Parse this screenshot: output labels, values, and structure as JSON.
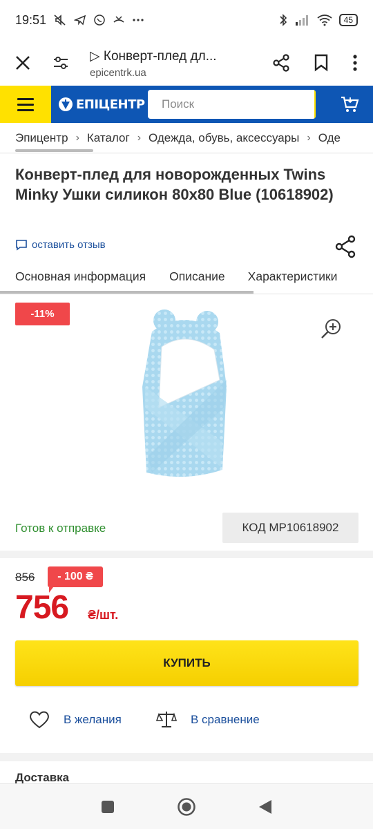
{
  "status_bar": {
    "time": "19:51",
    "battery": "45"
  },
  "browser": {
    "title": "▷ Конверт-плед дл...",
    "url": "epicentrk.ua"
  },
  "site": {
    "logo_text": "ЕПІЦЕНТР",
    "search_placeholder": "Поиск",
    "brand_yellow": "#ffe100",
    "brand_blue": "#0e56b4"
  },
  "breadcrumb": [
    "Эпицентр",
    "Каталог",
    "Одежда, обувь, аксессуары",
    "Оде"
  ],
  "product": {
    "title": "Конверт-плед для новорожденных Twins Minky Ушки силикон 80х80 Blue (10618902)",
    "review_link": "оставить отзыв",
    "discount_badge": "-11%",
    "availability": "Готов к отправке",
    "code": "КОД MP10618902",
    "old_price": "856",
    "save_badge": "- 100 ₴",
    "price": "756",
    "price_unit": "₴/шт.",
    "buy_label": "КУПИТЬ",
    "wishlist_label": "В желания",
    "compare_label": "В сравнение",
    "delivery_heading": "Доставка"
  },
  "tabs": [
    "Основная информация",
    "Описание",
    "Характеристики"
  ],
  "icons": {
    "close": "close-icon",
    "tune": "tune-icon",
    "share": "share-icon",
    "bookmark": "bookmark-icon",
    "more": "more-vert-icon",
    "menu": "menu-icon",
    "search": "search-icon",
    "cart": "cart-icon",
    "comment": "comment-icon",
    "zoom": "zoom-in-icon",
    "heart": "heart-icon",
    "scales": "scales-icon"
  }
}
